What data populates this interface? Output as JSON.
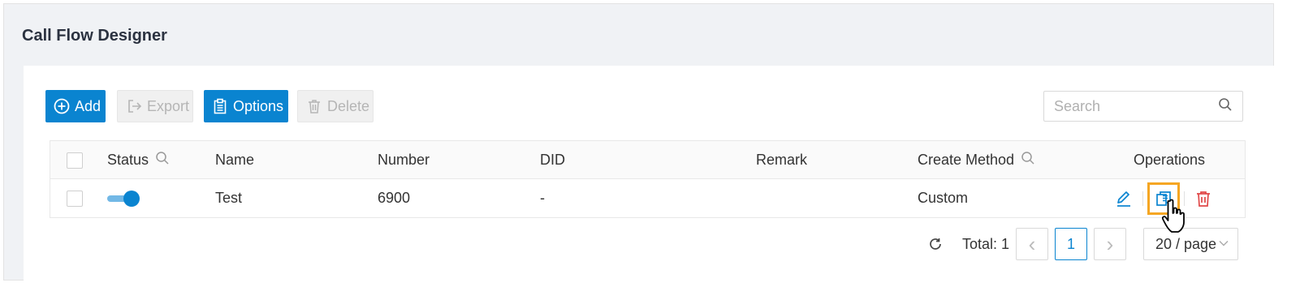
{
  "page": {
    "title": "Call Flow Designer"
  },
  "toolbar": {
    "add_label": "Add",
    "export_label": "Export",
    "options_label": "Options",
    "delete_label": "Delete",
    "search_placeholder": "Search"
  },
  "table": {
    "columns": [
      "Status",
      "Name",
      "Number",
      "DID",
      "Remark",
      "Create Method",
      "Operations"
    ],
    "rows": [
      {
        "status": "on",
        "name": "Test",
        "number": "6900",
        "did": "-",
        "remark": "",
        "create_method": "Custom"
      }
    ]
  },
  "pagination": {
    "total_label": "Total: 1",
    "current_page": "1",
    "prev_icon": "‹",
    "next_icon": "›",
    "page_size": "20 / page"
  },
  "colors": {
    "primary": "#0a84d0",
    "danger": "#e04848",
    "highlight": "#f5a623"
  }
}
